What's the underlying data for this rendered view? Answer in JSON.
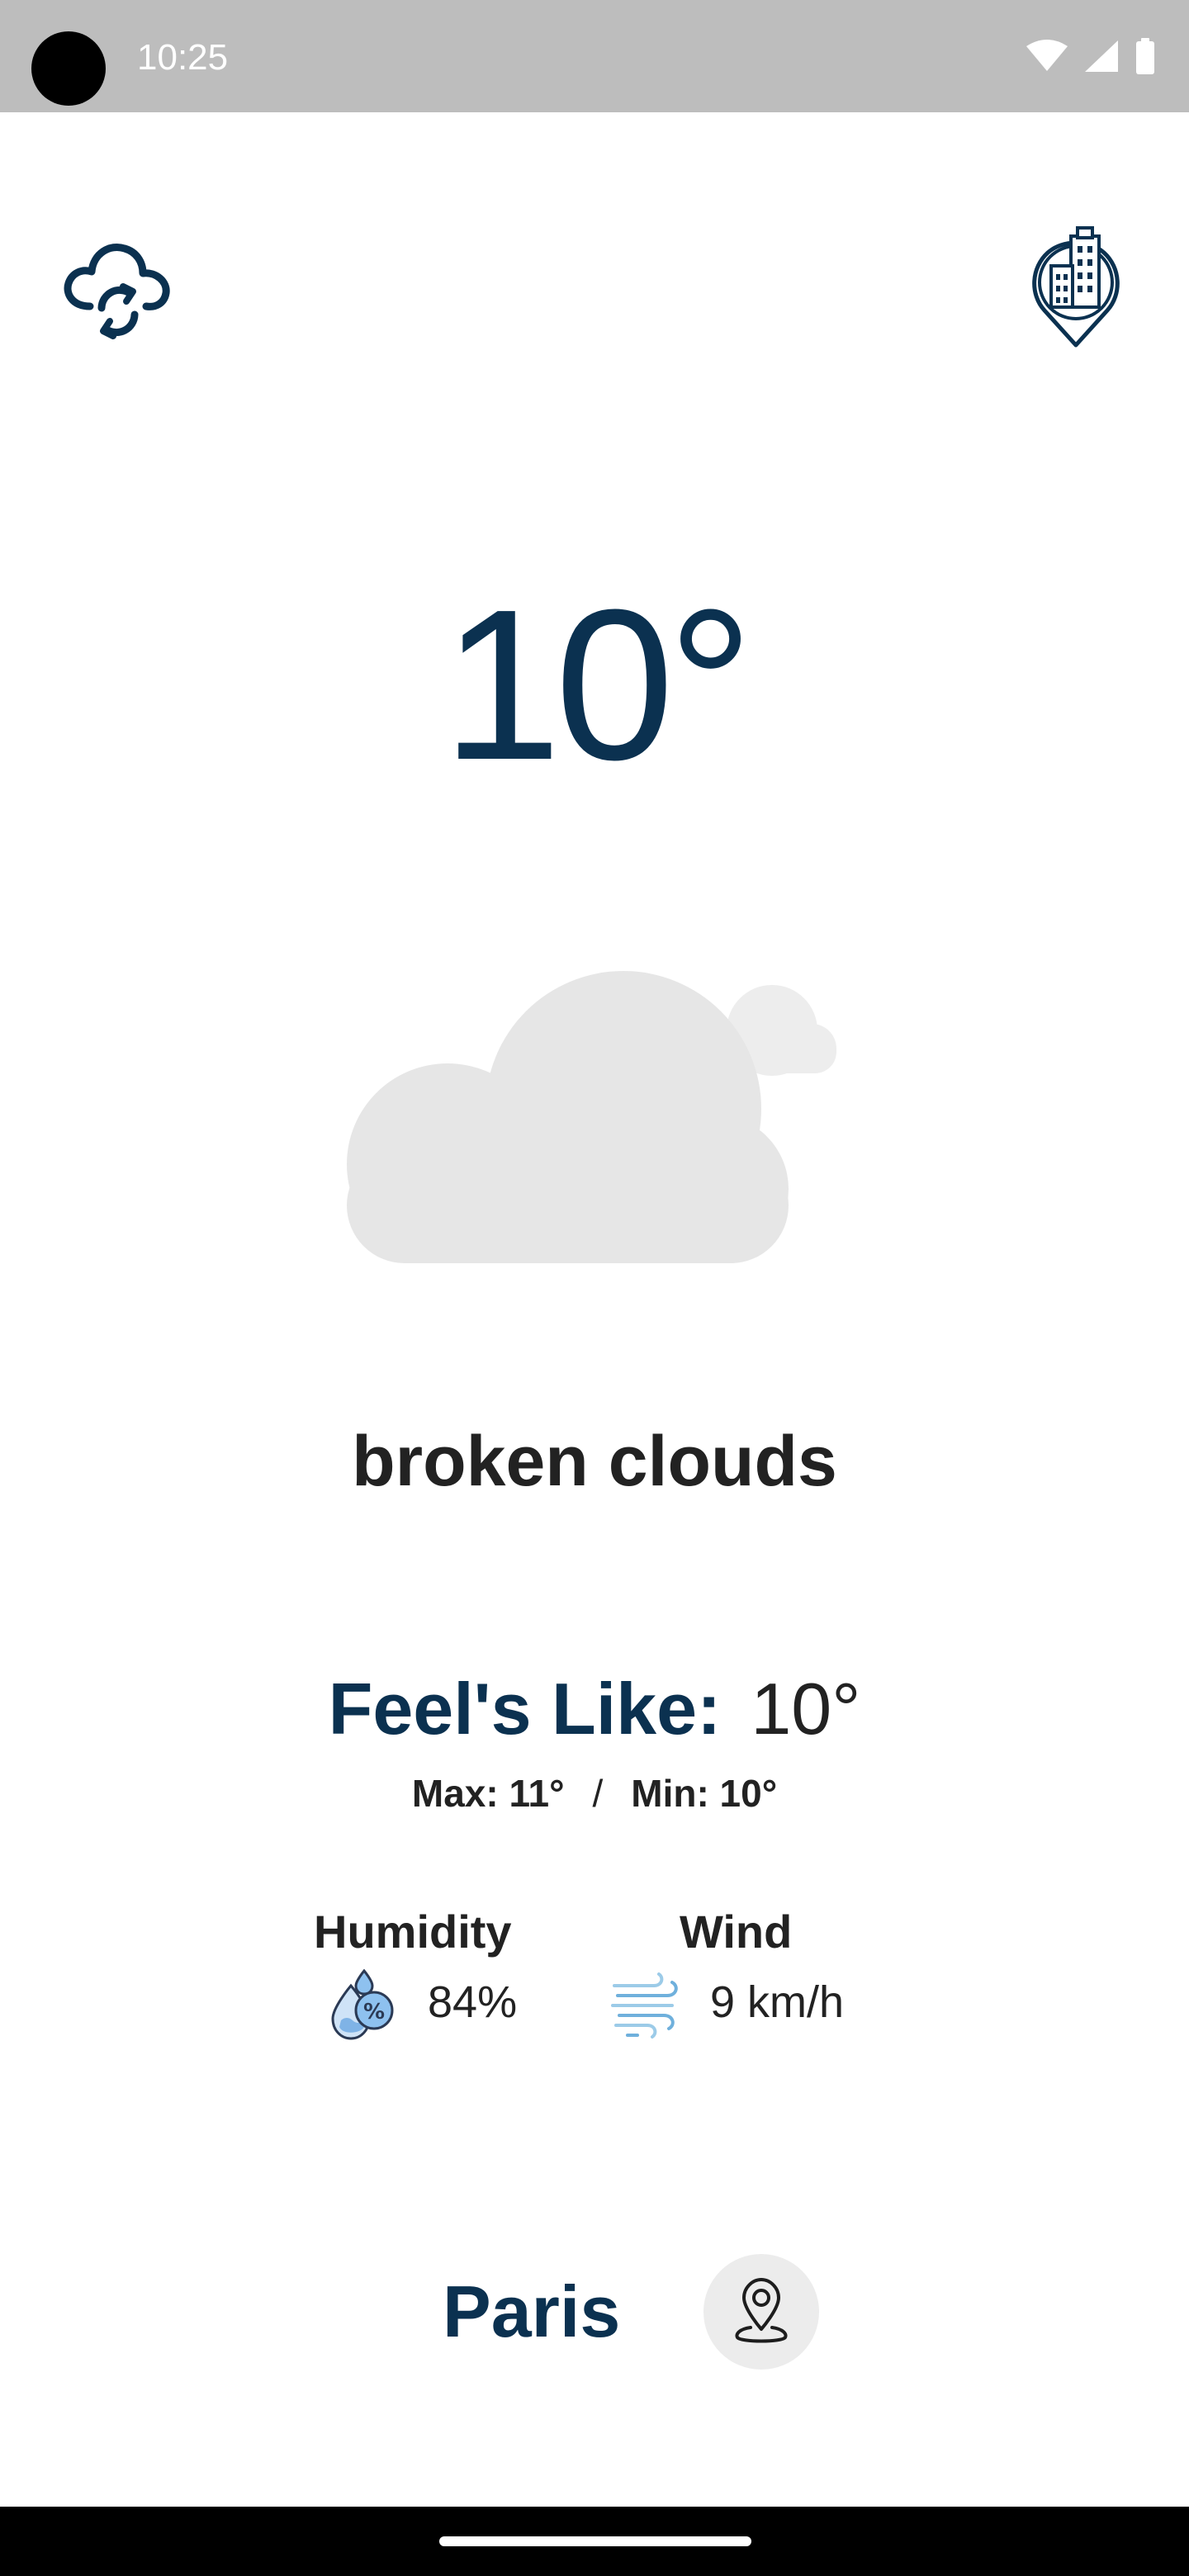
{
  "status_bar": {
    "time": "10:25",
    "icons": [
      "wifi-icon",
      "cellular-signal-icon",
      "battery-icon"
    ]
  },
  "header": {
    "refresh_icon": "cloud-refresh-icon",
    "city_icon": "city-location-icon"
  },
  "weather": {
    "temperature": "10°",
    "condition": "broken clouds",
    "illustration": "broken-clouds-icon",
    "feels_like_label": "Feel's Like:",
    "feels_like_value": "10°",
    "max": "Max: 11°",
    "separator": "/",
    "min": "Min: 10°"
  },
  "stats": {
    "humidity_label": "Humidity",
    "humidity_value": "84%",
    "humidity_icon": "humidity-drop-icon",
    "wind_label": "Wind",
    "wind_value": "9 km/h",
    "wind_icon": "wind-icon"
  },
  "location": {
    "city": "Paris",
    "icon": "location-pin-icon"
  },
  "colors": {
    "primary": "#0b3150",
    "text": "#222222",
    "cloud": "#e6e6e6",
    "status_bar": "#bdbdbd"
  }
}
